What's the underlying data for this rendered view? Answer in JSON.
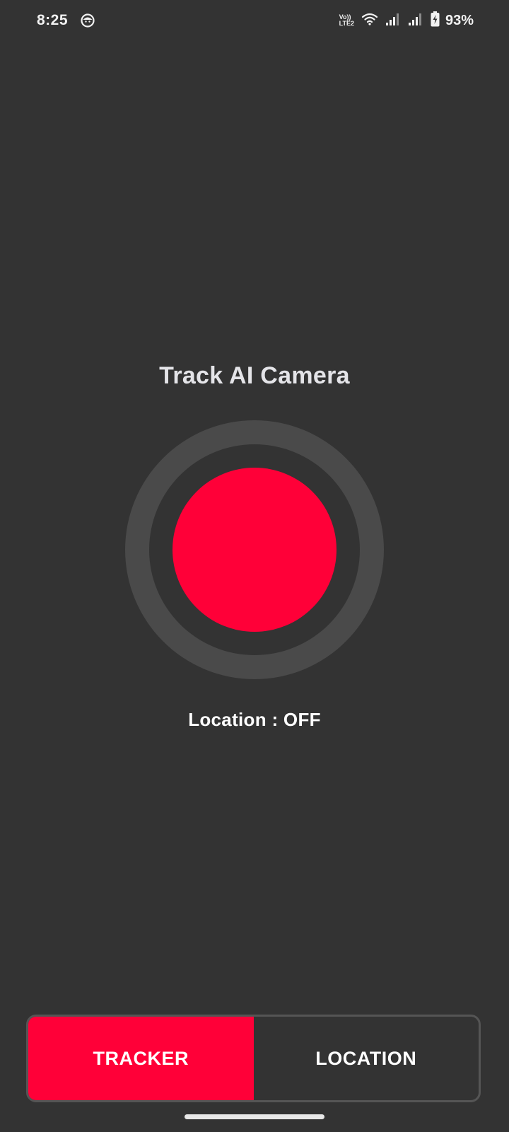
{
  "status_bar": {
    "time": "8:25",
    "volte_top": "Vo))",
    "volte_bottom": "LTE2",
    "battery_percent": "93%",
    "icons": [
      "app-notification-icon",
      "wifi-icon",
      "signal-icon",
      "signal-icon",
      "battery-charging-icon"
    ]
  },
  "main": {
    "title": "Track AI Camera",
    "location_status": "Location : OFF",
    "record_color": "#ff0038"
  },
  "tabs": [
    {
      "label": "TRACKER",
      "active": true
    },
    {
      "label": "LOCATION",
      "active": false
    }
  ],
  "colors": {
    "background": "#333333",
    "accent": "#ff0038",
    "ring": "#4a4a4a"
  }
}
